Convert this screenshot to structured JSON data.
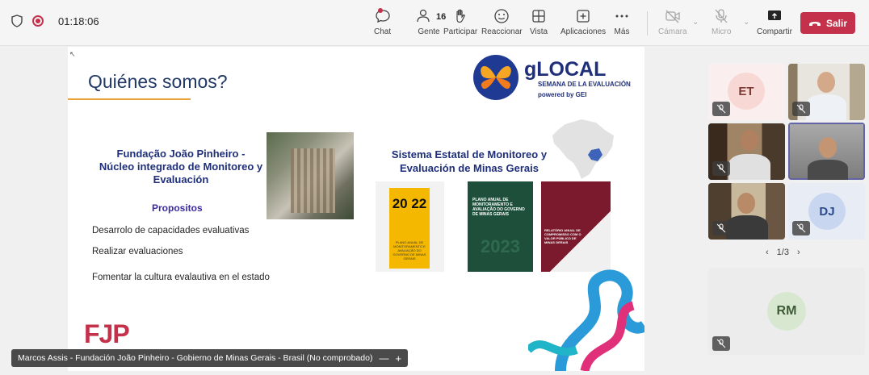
{
  "toolbar": {
    "timer": "01:18:06",
    "chat_label": "Chat",
    "people_label": "Gente",
    "people_count": "16",
    "raise_label": "Participar",
    "react_label": "Reaccionar",
    "view_label": "Vista",
    "apps_label": "Aplicaciones",
    "more_label": "Más",
    "camera_label": "Cámara",
    "mic_label": "Micro",
    "share_label": "Compartir",
    "leave_label": "Salir"
  },
  "slide": {
    "title": "Quiénes somos?",
    "logo_name": "gLOCAL",
    "logo_sub": "SEMANA DE LA EVALUACIÓN",
    "logo_powered": "powered by GEI",
    "fjp_line1": "Fundação João Pinheiro -",
    "fjp_line2": "Núcleo integrado de Monitoreo y",
    "fjp_line3": "Evaluación",
    "propositos": "Propositos",
    "bullets": [
      "Desarrolo de capacidades evaluativas",
      "Realizar evaluaciones",
      "Fomentar la cultura evalautiva en el estado"
    ],
    "sis_line1": "Sistema Estatal de Monitoreo y",
    "sis_line2": "Evaluación de Minas Gerais",
    "book1_year": "20 22",
    "book1_text": "PLANO ANUAL DE MONITORAMENTO E AVALIAÇÃO DO GOVERNO DE MINAS GERAIS",
    "book2_text": "PLANO ANUAL DE MONITORAMENTO E AVALIAÇÃO DO GOVERNO DE MINAS GERAIS",
    "book2_year": "2023",
    "book3_text": "RELATÓRIO ANUAL DE COMPROMISSO COM O VALOR PÚBLICO DE MINAS GERAIS",
    "fjp_logo": "FJP"
  },
  "speaker": {
    "name_tag": "Marcos Assis - Fundación João Pinheiro - Gobierno de Minas Gerais - Brasil (No comprobado)"
  },
  "participants": {
    "et_initials": "ET",
    "dj_initials": "DJ",
    "rm_initials": "RM",
    "page": "1/3"
  },
  "colors": {
    "accent_red": "#c4314b",
    "slide_title": "#1f3864",
    "brand_blue": "#1f2f7a"
  }
}
